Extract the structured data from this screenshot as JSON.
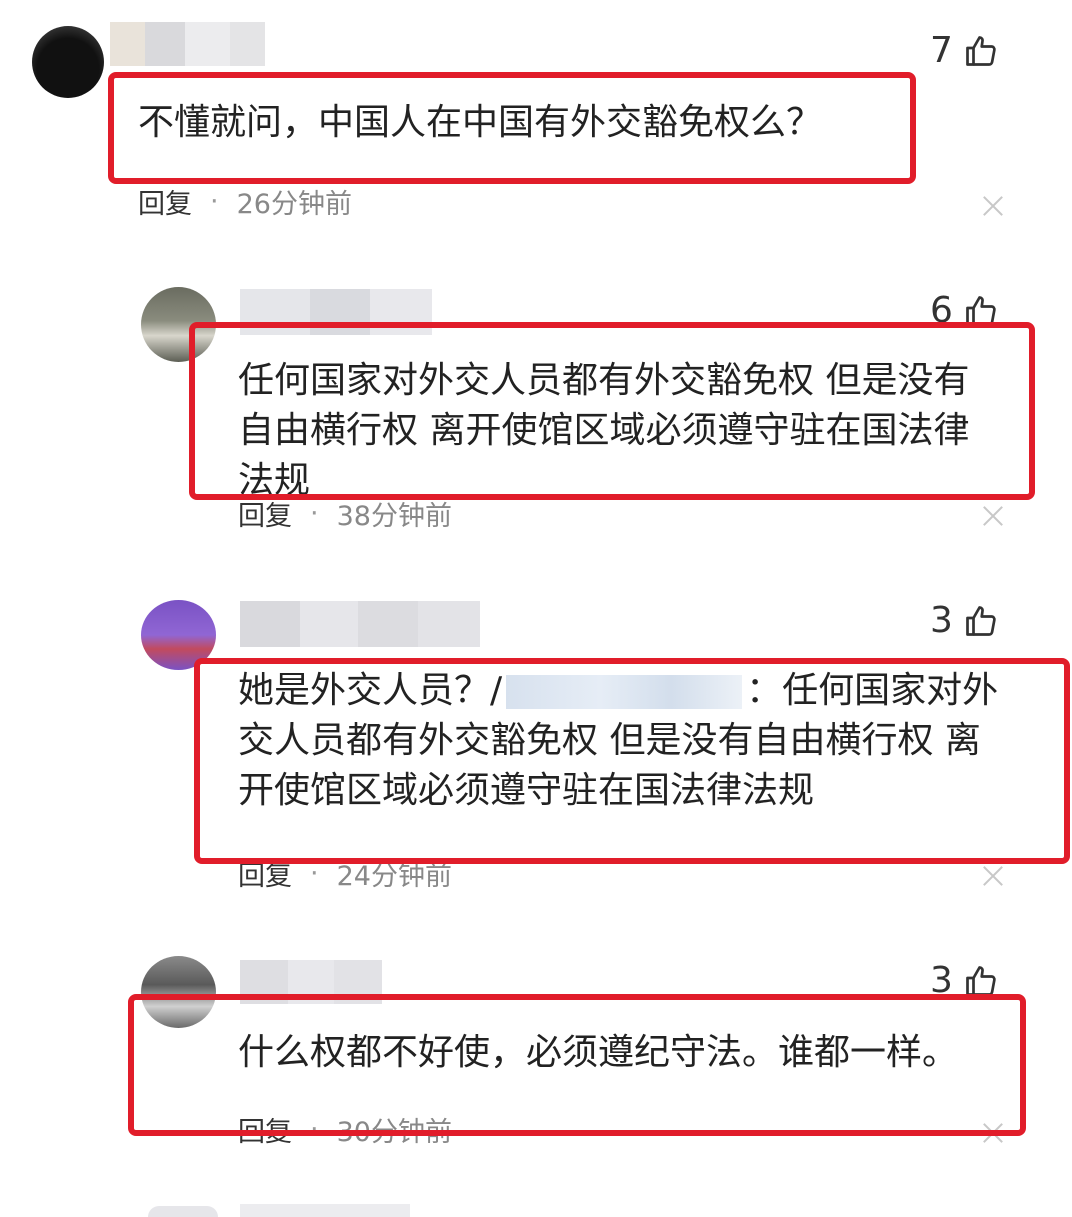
{
  "comments": [
    {
      "likes": "7",
      "text": "不懂就问，中国人在中国有外交豁免权么？",
      "reply_label": "回复",
      "separator": "·",
      "time": "26分钟前"
    },
    {
      "likes": "6",
      "text": "任何国家对外交人员都有外交豁免权 但是没有自由横行权 离开使馆区域必须遵守驻在国法律法规",
      "reply_label": "回复",
      "separator": "·",
      "time": "38分钟前"
    },
    {
      "likes": "3",
      "text_prefix": "她是外交人员？/",
      "text_suffix": "：任何国家对外交人员都有外交豁免权 但是没有自由横行权 离开使馆区域必须遵守驻在国法律法规",
      "reply_label": "回复",
      "separator": "·",
      "time": "24分钟前"
    },
    {
      "likes": "3",
      "text": "什么权都不好使，必须遵纪守法。谁都一样。",
      "reply_label": "回复",
      "separator": "·",
      "time": "30分钟前"
    }
  ],
  "colors": {
    "highlight": "#e11d2a",
    "text": "#222222",
    "meta": "#888888"
  }
}
